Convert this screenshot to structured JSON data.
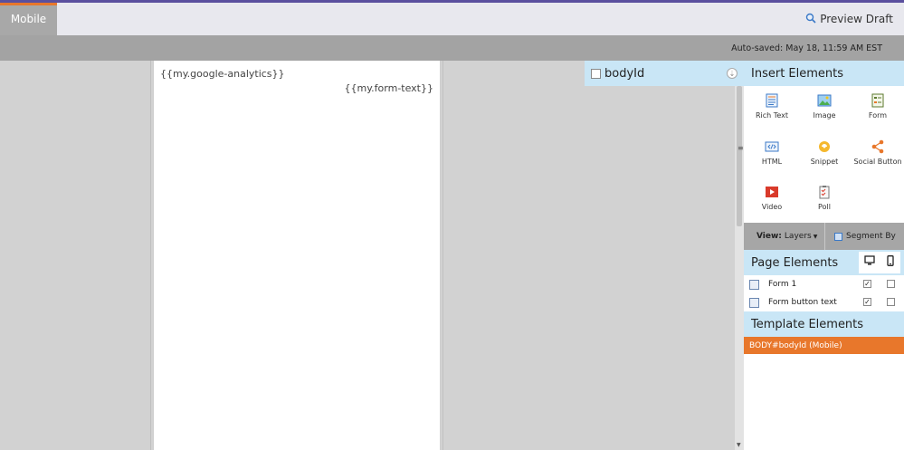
{
  "topbar": {
    "tab_mobile": "Mobile",
    "preview_draft": "Preview Draft",
    "accent_color": "#e8772b",
    "brand_bar_color": "#5a4f9e"
  },
  "subbar": {
    "autosave": "Auto-saved: May 18, 11:59 AM EST"
  },
  "canvas": {
    "tokens": [
      "{{my.google-analytics}}",
      "{{my.form-text}}"
    ]
  },
  "selected_element": {
    "label": "bodyId"
  },
  "insert_panel": {
    "title": "Insert Elements",
    "items": [
      {
        "label": "Rich Text",
        "icon": "rich-text-icon"
      },
      {
        "label": "Image",
        "icon": "image-icon"
      },
      {
        "label": "Form",
        "icon": "form-icon"
      },
      {
        "label": "HTML",
        "icon": "html-icon"
      },
      {
        "label": "Snippet",
        "icon": "snippet-icon"
      },
      {
        "label": "Social Button",
        "icon": "share-icon"
      },
      {
        "label": "Video",
        "icon": "video-icon"
      },
      {
        "label": "Poll",
        "icon": "poll-icon"
      }
    ]
  },
  "view_bar": {
    "view_label": "View:",
    "view_value": "Layers",
    "segment_label": "Segment By"
  },
  "page_elements": {
    "title": "Page Elements",
    "rows": [
      {
        "label": "Form 1",
        "desktop": true,
        "mobile": false
      },
      {
        "label": "Form button text",
        "desktop": true,
        "mobile": false
      }
    ]
  },
  "template_elements": {
    "title": "Template Elements",
    "rows": [
      {
        "label": "BODY#bodyId (Mobile)"
      }
    ]
  }
}
